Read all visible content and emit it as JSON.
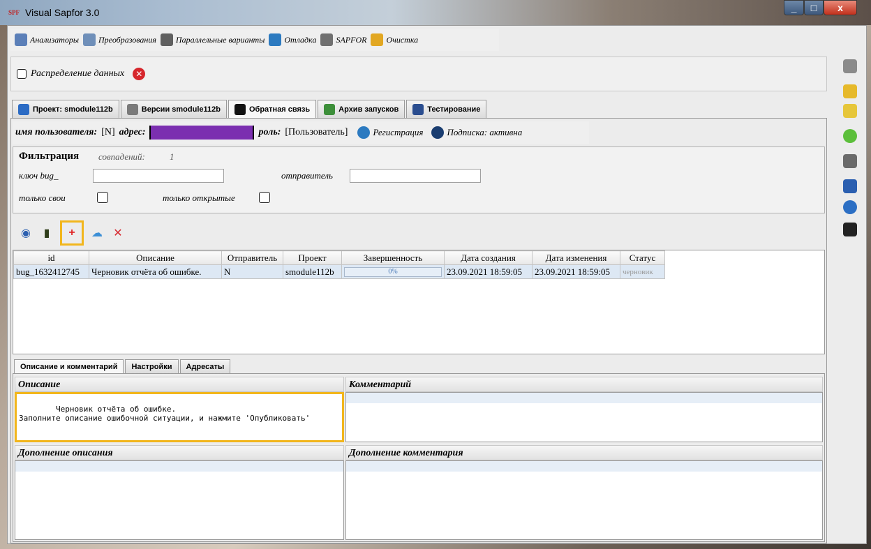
{
  "window": {
    "icon_text": "SPF",
    "title": "Visual Sapfor 3.0",
    "minimize": "_",
    "maximize": "□",
    "close": "x"
  },
  "menu": [
    {
      "label": "Анализаторы",
      "icon": "analyzer-icon",
      "color": "#5b7fb8"
    },
    {
      "label": "Преобразования",
      "icon": "transform-icon",
      "color": "#6f8fb9"
    },
    {
      "label": "Параллельные варианты",
      "icon": "parallel-icon",
      "color": "#606060"
    },
    {
      "label": "Отладка",
      "icon": "debug-icon",
      "color": "#2c7ac0"
    },
    {
      "label": "SAPFOR",
      "icon": "sapfor-icon",
      "color": "#707070"
    },
    {
      "label": "Очистка",
      "icon": "broom-icon",
      "color": "#e2a722"
    }
  ],
  "distribution": {
    "label": "Распределение данных",
    "close": "✕"
  },
  "project_tabs": [
    {
      "label": "Проект: smodule112b",
      "icon": "project-icon",
      "color": "#2b6bc4"
    },
    {
      "label": "Версии smodule112b",
      "icon": "tree-icon",
      "color": "#7a7a7a"
    },
    {
      "label": "Обратная связь",
      "icon": "bug-icon",
      "color": "#111111",
      "active": true
    },
    {
      "label": "Архив запусков",
      "icon": "archive-icon",
      "color": "#3d8f3a"
    },
    {
      "label": "Тестирование",
      "icon": "testing-icon",
      "color": "#2a4d8f"
    }
  ],
  "userbar": {
    "user_label": "имя пользователя:",
    "user_value": "[N]",
    "address_label": "адрес:",
    "address_bracket_open": "[",
    "address_bracket_close": "]",
    "role_label": "роль:",
    "role_value": "[Пользователь]",
    "register": "Регистрация",
    "subscription": "Подписка: активна"
  },
  "filter": {
    "title": "Фильтрация",
    "matches_label": "совпадений:",
    "matches_value": "1",
    "key_label": "ключ bug_",
    "key_value": "",
    "sender_label": "отправитель",
    "sender_value": "",
    "own_only": "только свои",
    "open_only": "только открытые"
  },
  "actions": [
    {
      "name": "sync-icon",
      "glyph": "◉",
      "color": "#2b5fb0"
    },
    {
      "name": "book-icon",
      "glyph": "▮",
      "color": "#2f3d1a"
    },
    {
      "name": "add-icon",
      "glyph": "+",
      "color": "#e02020",
      "highlight": true
    },
    {
      "name": "upload-cloud-icon",
      "glyph": "☁",
      "color": "#3c8fd6"
    },
    {
      "name": "delete-icon",
      "glyph": "✕",
      "color": "#d6262c"
    }
  ],
  "table": {
    "columns": [
      "id",
      "Описание",
      "Отправитель",
      "Проект",
      "Завершенность",
      "Дата создания",
      "Дата изменения",
      "Статус"
    ],
    "rows": [
      {
        "id": "bug_1632412745",
        "description": "Черновик отчёта об ошибке.",
        "sender": "N",
        "project": "smodule112b",
        "completeness": "0%",
        "created": "23.09.2021 18:59:05",
        "modified": "23.09.2021 18:59:05",
        "status": "черновик"
      }
    ]
  },
  "bottom_tabs": [
    "Описание и комментарий",
    "Настройки",
    "Адресаты"
  ],
  "description": {
    "header": "Описание",
    "text": "Черновик отчёта об ошибке.\nЗаполните описание ошибочной ситуации, и нажмите 'Опубликовать'"
  },
  "comment": {
    "header": "Комментарий",
    "text": ""
  },
  "description_addendum": {
    "header": "Дополнение описания",
    "text": ""
  },
  "comment_addendum": {
    "header": "Дополнение комментария",
    "text": ""
  },
  "right_sidebar": [
    {
      "name": "user-key-icon",
      "color": "#8a8a8a"
    },
    {
      "name": "folder-open-icon",
      "color": "#e6b92a"
    },
    {
      "name": "folder-add-icon",
      "color": "#e6c63a"
    },
    {
      "name": "close-green-icon",
      "color": "#5cbf3b"
    },
    {
      "name": "sapfor-side-icon",
      "color": "#6a6a6a"
    },
    {
      "name": "sync-side-icon",
      "color": "#2b5fb0"
    },
    {
      "name": "help-icon",
      "color": "#2c6fc4"
    },
    {
      "name": "camera-icon",
      "color": "#222222"
    }
  ]
}
